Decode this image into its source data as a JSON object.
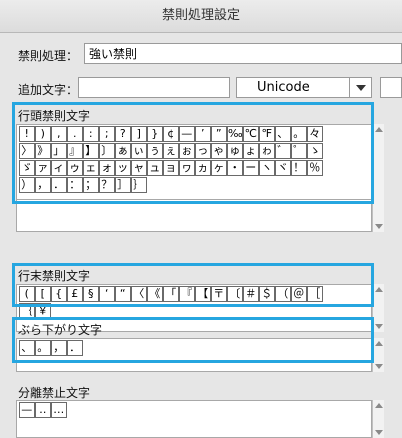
{
  "window": {
    "title": "禁則処理設定"
  },
  "kinsoku": {
    "label": "禁則処理：",
    "value": "強い禁則"
  },
  "add_char": {
    "label": "追加文字：",
    "value": "",
    "encoding": "Unicode"
  },
  "sections": [
    {
      "title": "行頭禁則文字",
      "lines": [
        [
          "!",
          ")",
          ",",
          ".",
          ":",
          ";",
          "?",
          "]",
          "}",
          "¢",
          "—",
          "’",
          "”",
          "‰",
          "℃",
          "℉",
          "、",
          "。",
          "々"
        ],
        [
          "〉",
          "》",
          "」",
          "』",
          "】",
          "〕",
          "ぁ",
          "ぃ",
          "ぅ",
          "ぇ",
          "ぉ",
          "っ",
          "ゃ",
          "ゅ",
          "ょ",
          "ゎ",
          "゛",
          "゜",
          "ゝ"
        ],
        [
          "ゞ",
          "ァ",
          "ィ",
          "ゥ",
          "ェ",
          "ォ",
          "ッ",
          "ャ",
          "ュ",
          "ョ",
          "ヮ",
          "ヵ",
          "ヶ",
          "・",
          "ー",
          "ヽ",
          "ヾ",
          "！",
          "％"
        ],
        [
          "）",
          "，",
          "．",
          "：",
          "；",
          "？",
          "］",
          "｝"
        ]
      ]
    },
    {
      "title": "行末禁則文字",
      "lines": [
        [
          "(",
          "[",
          "{",
          "£",
          "§",
          "‘",
          "“",
          "〈",
          "《",
          "「",
          "『",
          "【",
          "〒",
          "〔",
          "＃",
          "＄",
          "（",
          "＠",
          "［"
        ],
        [
          "｛",
          "￥"
        ]
      ]
    },
    {
      "title": "ぶら下がり文字",
      "lines": [
        [
          "、",
          "。",
          "，",
          "．"
        ]
      ]
    },
    {
      "title": "分離禁止文字",
      "lines": [
        [
          "—",
          "‥",
          "…"
        ]
      ]
    }
  ],
  "colors": {
    "highlight": "#26a6e0",
    "background": "#e6e6e6"
  }
}
